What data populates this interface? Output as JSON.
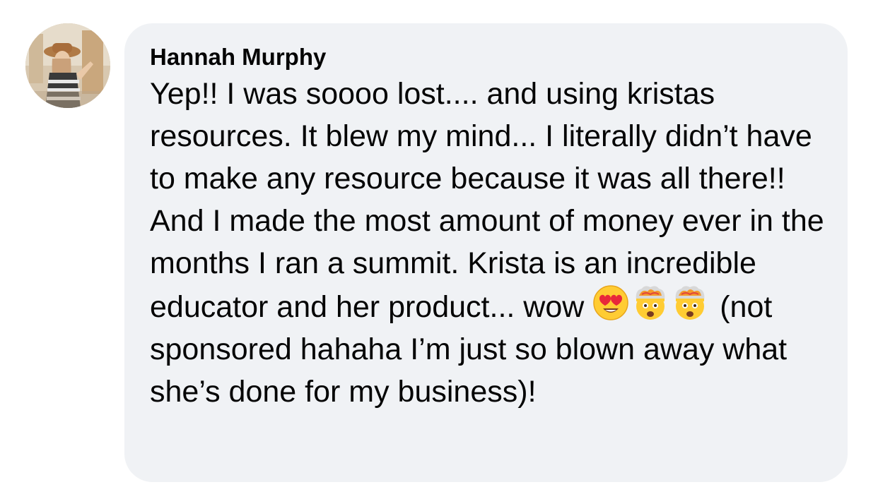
{
  "comment": {
    "author": "Hannah Murphy",
    "text_part1": "Yep!! I was soooo lost.... and using kristas resources. It blew my mind... I literally didn’t have to make any resource because it was all there!! And I made the most amount of money ever in the months I ran a summit. Krista is an incredible educator and her product... wow ",
    "emojis": [
      "heart-eyes-emoji",
      "exploding-head-emoji",
      "exploding-head-emoji"
    ],
    "text_part2": " (not sponsored hahaha I’m just so blown away what she’s done for my business)!"
  },
  "colors": {
    "bubble": "#f0f2f5",
    "text": "#050505"
  }
}
